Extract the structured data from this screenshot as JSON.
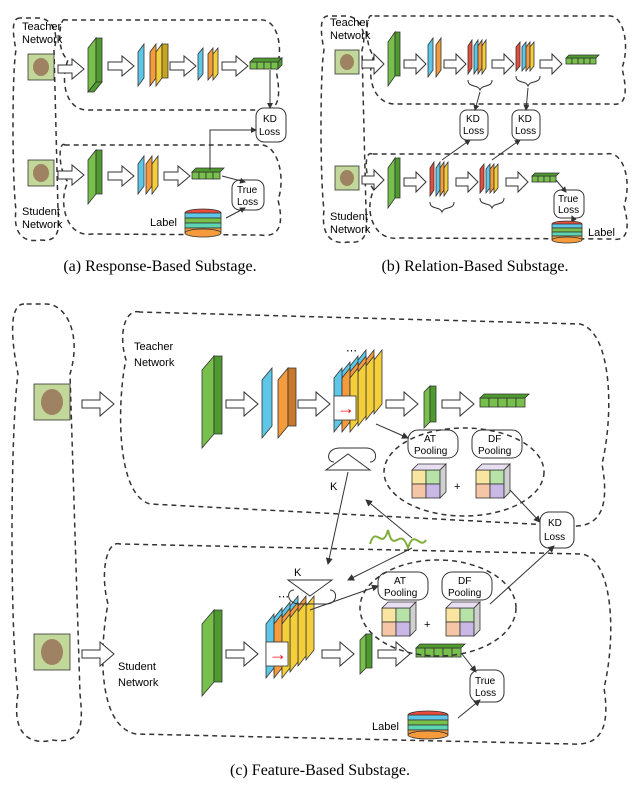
{
  "panels": {
    "a": {
      "caption": "(a) Response-Based Substage."
    },
    "b": {
      "caption": "(b) Relation-Based Substage."
    },
    "c": {
      "caption": "(c) Feature-Based Substage."
    }
  },
  "labels": {
    "teacher": "Teacher",
    "network": "Network",
    "student": "Student",
    "label": "Label",
    "kd": "KD",
    "loss": "Loss",
    "true": "True",
    "at": "AT",
    "df": "DF",
    "pool": "Pooling",
    "k": "K",
    "plus": "+"
  },
  "icons": {
    "arrow": "⇨",
    "redarrow": "→"
  },
  "colors": {
    "green": "#77C04B",
    "blue": "#5EC7E8",
    "orange": "#F59B3C",
    "yellow": "#F4CF3A",
    "red": "#E74C3C",
    "teal": "#5ED5B2",
    "purple": "#B49BD8"
  }
}
